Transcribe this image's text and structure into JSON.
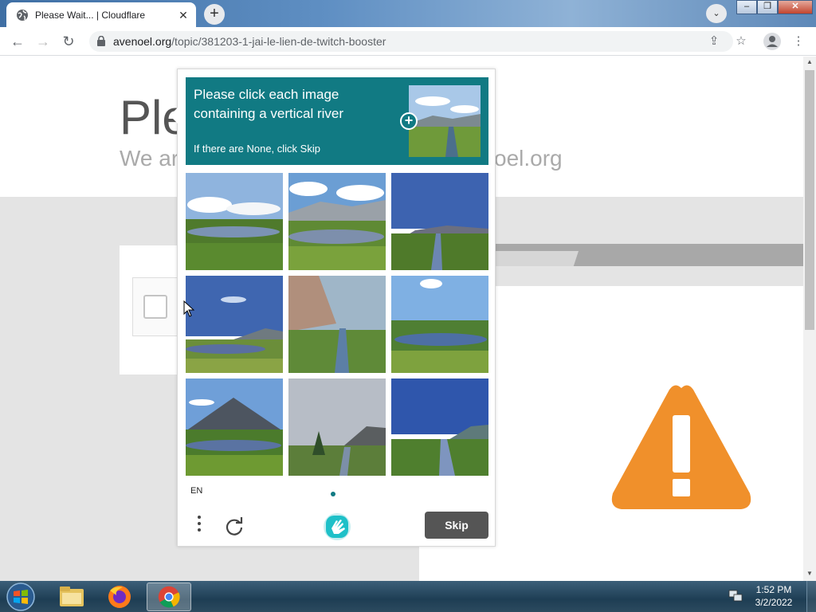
{
  "browser": {
    "tab_title": "Please Wait... | Cloudflare",
    "tab_close": "✕",
    "new_tab": "+",
    "tab_list": "⌄",
    "url_domain": "avenoel.org",
    "url_path": "/topic/381203-1-jai-le-lien-de-twitch-booster",
    "back": "←",
    "forward": "→",
    "reload": "↻",
    "share": "⇪",
    "star": "☆",
    "menu": "⋮",
    "window_min": "‒",
    "window_max": "❐",
    "window_close": "✕"
  },
  "page": {
    "title_fragment": "Ple",
    "subtitle_left_fragment": "We ar",
    "subtitle_right_fragment": "oel.org",
    "warning_color": "#f0902b"
  },
  "captcha": {
    "question": "Please click each image containing a vertical river",
    "hint": "If there are None, click Skip",
    "language": "EN",
    "skip_label": "Skip",
    "accent_color": "#117a83",
    "tiles": [
      {
        "name": "tile-1"
      },
      {
        "name": "tile-2"
      },
      {
        "name": "tile-3"
      },
      {
        "name": "tile-4"
      },
      {
        "name": "tile-5"
      },
      {
        "name": "tile-6"
      },
      {
        "name": "tile-7"
      },
      {
        "name": "tile-8"
      },
      {
        "name": "tile-9"
      }
    ]
  },
  "taskbar": {
    "time": "1:52 PM",
    "date": "3/2/2022",
    "apps": [
      "windows-explorer",
      "firefox",
      "chrome"
    ]
  }
}
